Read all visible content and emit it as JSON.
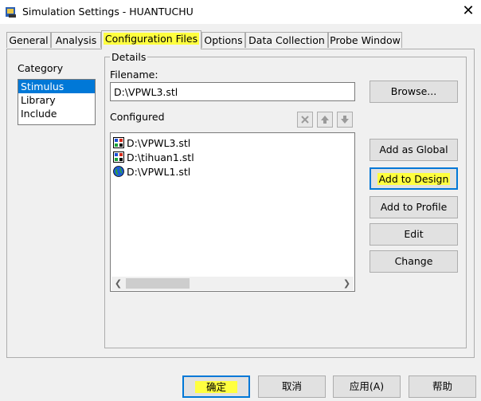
{
  "window": {
    "title": "Simulation Settings - HUANTUCHU",
    "close_glyph": "✕",
    "icon": "app-icon"
  },
  "tabs": [
    {
      "label": "General",
      "active": false
    },
    {
      "label": "Analysis",
      "active": false
    },
    {
      "label": "Configuration Files",
      "active": true,
      "highlighted": true
    },
    {
      "label": "Options",
      "active": false
    },
    {
      "label": "Data Collection",
      "active": false
    },
    {
      "label": "Probe Window",
      "active": false
    }
  ],
  "category": {
    "label": "Category",
    "items": [
      {
        "label": "Stimulus",
        "selected": true
      },
      {
        "label": "Library",
        "selected": false
      },
      {
        "label": "Include",
        "selected": false
      }
    ]
  },
  "details": {
    "title": "Details",
    "filename_label": "Filename:",
    "filename_value": "D:\\VPWL3.stl",
    "configured_label": "Configured",
    "toolbar_icons": [
      "delete-icon",
      "move-up-icon",
      "move-down-icon"
    ],
    "configured_items": [
      {
        "label": "D:\\VPWL3.stl",
        "icon": "file-local-icon"
      },
      {
        "label": "D:\\tihuan1.stl",
        "icon": "file-local-icon"
      },
      {
        "label": "D:\\VPWL1.stl",
        "icon": "globe-icon"
      }
    ]
  },
  "side_buttons": {
    "browse": "Browse...",
    "add_global": "Add as Global",
    "add_design": "Add to Design",
    "add_profile": "Add to Profile",
    "edit": "Edit",
    "change": "Change"
  },
  "bottom_buttons": {
    "ok": "确定",
    "cancel": "取消",
    "apply": "应用(A)",
    "help": "帮助"
  },
  "colors": {
    "highlight": "#ffff40",
    "selection": "#0078d7",
    "focus_border": "#0078d7"
  }
}
